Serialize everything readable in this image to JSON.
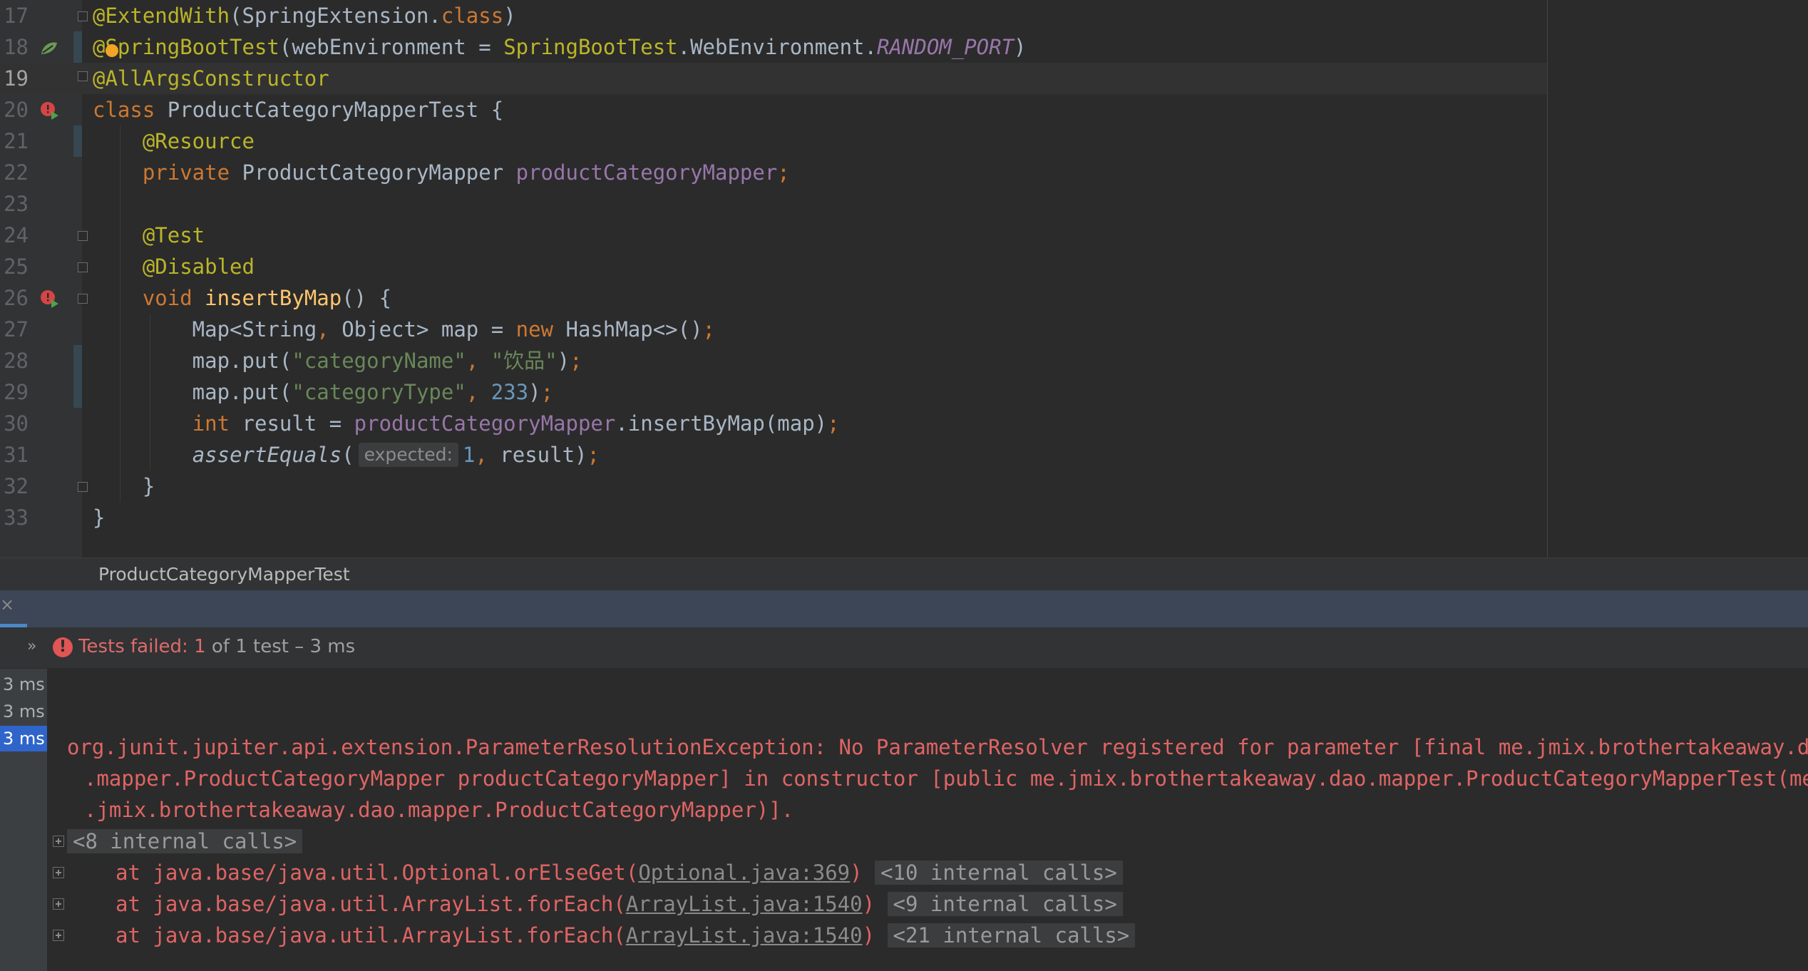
{
  "editor": {
    "lines": [
      {
        "num": "17",
        "parts": [
          {
            "t": "@ExtendWith",
            "c": "an"
          },
          {
            "t": "(SpringExtension.",
            "c": ""
          },
          {
            "t": "class",
            "c": "k"
          },
          {
            "t": ")",
            "c": ""
          }
        ]
      },
      {
        "num": "18",
        "parts": [
          {
            "t": "@SpringBootTest",
            "c": "an"
          },
          {
            "t": "(webEnvironment = ",
            "c": ""
          },
          {
            "t": "SpringBootTest",
            "c": "an"
          },
          {
            "t": ".WebEnvironment.",
            "c": ""
          },
          {
            "t": "RANDOM_PORT",
            "c": "fi"
          },
          {
            "t": ")",
            "c": ""
          }
        ]
      },
      {
        "num": "19",
        "parts": [
          {
            "t": "@AllArgsConstructor",
            "c": "an"
          }
        ]
      },
      {
        "num": "20",
        "parts": [
          {
            "t": "class ",
            "c": "k"
          },
          {
            "t": "ProductCategoryMapperTest {",
            "c": ""
          }
        ]
      },
      {
        "num": "21",
        "parts": [
          {
            "t": "    ",
            "c": ""
          },
          {
            "t": "@Resource",
            "c": "an"
          }
        ]
      },
      {
        "num": "22",
        "parts": [
          {
            "t": "    ",
            "c": ""
          },
          {
            "t": "private ",
            "c": "k"
          },
          {
            "t": "ProductCategoryMapper ",
            "c": ""
          },
          {
            "t": "productCategoryMapper",
            "c": "f"
          },
          {
            "t": ";",
            "c": "k"
          }
        ]
      },
      {
        "num": "23",
        "parts": []
      },
      {
        "num": "24",
        "parts": [
          {
            "t": "    ",
            "c": ""
          },
          {
            "t": "@Test",
            "c": "an"
          }
        ]
      },
      {
        "num": "25",
        "parts": [
          {
            "t": "    ",
            "c": ""
          },
          {
            "t": "@Disabled",
            "c": "an"
          }
        ]
      },
      {
        "num": "26",
        "parts": [
          {
            "t": "    ",
            "c": ""
          },
          {
            "t": "void ",
            "c": "k"
          },
          {
            "t": "insertByMap",
            "c": "fn"
          },
          {
            "t": "() {",
            "c": ""
          }
        ]
      },
      {
        "num": "27",
        "parts": [
          {
            "t": "        Map<String",
            "c": ""
          },
          {
            "t": ", ",
            "c": "k"
          },
          {
            "t": "Object> map = ",
            "c": ""
          },
          {
            "t": "new ",
            "c": "k"
          },
          {
            "t": "HashMap<>()",
            "c": ""
          },
          {
            "t": ";",
            "c": "k"
          }
        ]
      },
      {
        "num": "28",
        "parts": [
          {
            "t": "        map.put(",
            "c": ""
          },
          {
            "t": "\"categoryName\"",
            "c": "s"
          },
          {
            "t": ", ",
            "c": "k"
          },
          {
            "t": "\"饮品\"",
            "c": "s"
          },
          {
            "t": ")",
            "c": ""
          },
          {
            "t": ";",
            "c": "k"
          }
        ]
      },
      {
        "num": "29",
        "parts": [
          {
            "t": "        map.put(",
            "c": ""
          },
          {
            "t": "\"categoryType\"",
            "c": "s"
          },
          {
            "t": ", ",
            "c": "k"
          },
          {
            "t": "233",
            "c": "n"
          },
          {
            "t": ")",
            "c": ""
          },
          {
            "t": ";",
            "c": "k"
          }
        ]
      },
      {
        "num": "30",
        "parts": [
          {
            "t": "        ",
            "c": ""
          },
          {
            "t": "int ",
            "c": "k"
          },
          {
            "t": "result = ",
            "c": ""
          },
          {
            "t": "productCategoryMapper",
            "c": "f"
          },
          {
            "t": ".insertByMap(map)",
            "c": ""
          },
          {
            "t": ";",
            "c": "k"
          }
        ]
      },
      {
        "num": "31",
        "parts": [
          {
            "t": "        ",
            "c": ""
          },
          {
            "t": "assertEquals",
            "c": "it"
          },
          {
            "t": "(",
            "c": ""
          },
          {
            "t": "expected:",
            "c": "hint"
          },
          {
            "t": "1",
            "c": "n"
          },
          {
            "t": ", ",
            "c": "k"
          },
          {
            "t": "result)",
            "c": ""
          },
          {
            "t": ";",
            "c": "k"
          }
        ]
      },
      {
        "num": "32",
        "parts": [
          {
            "t": "    }",
            "c": ""
          }
        ]
      },
      {
        "num": "33",
        "parts": [
          {
            "t": "}",
            "c": ""
          }
        ]
      }
    ]
  },
  "breadcrumb": {
    "label": "ProductCategoryMapperTest"
  },
  "run_panel": {
    "status_label": "Tests failed: ",
    "failed_count": "1",
    "status_rest": " of 1 test – 3 ms",
    "times": [
      "3 ms",
      "3 ms",
      "3 ms"
    ]
  },
  "console": {
    "exception_line1": "org.junit.jupiter.api.extension.ParameterResolutionException: No ParameterResolver registered for parameter [final me.jmix.brothertakeaway.dao",
    "exception_line2": ".mapper.ProductCategoryMapper productCategoryMapper] in constructor [public me.jmix.brothertakeaway.dao.mapper.ProductCategoryMapperTest(me",
    "exception_line3": ".jmix.brothertakeaway.dao.mapper.ProductCategoryMapper)].",
    "internal_calls_1": "<8 internal calls>",
    "frames": [
      {
        "prefix": "at java.base/java.util.Optional.orElseGet(",
        "link": "Optional.java:369",
        "suffix": ")",
        "internal": "<10 internal calls>"
      },
      {
        "prefix": "at java.base/java.util.ArrayList.forEach(",
        "link": "ArrayList.java:1540",
        "suffix": ")",
        "internal": "<9 internal calls>"
      },
      {
        "prefix": "at java.base/java.util.ArrayList.forEach(",
        "link": "ArrayList.java:1540",
        "suffix": ")",
        "internal": "<21 internal calls>"
      }
    ]
  },
  "colors": {
    "error": "#e06464",
    "selection": "#2f65ca",
    "annotation": "#bbb529",
    "keyword": "#cc7832",
    "string": "#6a8759"
  }
}
